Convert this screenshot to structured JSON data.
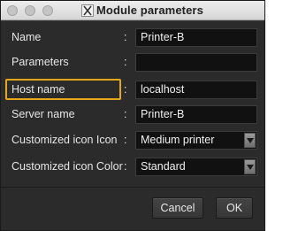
{
  "window": {
    "title": "Module parameters",
    "app_icon": "x-window-icon",
    "controls": [
      "close-button",
      "minimize-button",
      "zoom-button"
    ]
  },
  "form": {
    "fields": [
      {
        "label": "Name",
        "colon": ":",
        "value": "Printer-B",
        "type": "text"
      },
      {
        "label": "Parameters",
        "colon": ":",
        "value": "",
        "type": "text"
      },
      {
        "label": "Host name",
        "colon": ":",
        "value": "localhost",
        "type": "text",
        "highlighted": true
      },
      {
        "label": "Server name",
        "colon": ":",
        "value": "Printer-B",
        "type": "text"
      },
      {
        "label": "Customized icon Icon",
        "colon": ":",
        "value": "Medium printer",
        "type": "select"
      },
      {
        "label": "Customized icon Color",
        "colon": ":",
        "value": "Standard",
        "type": "select"
      }
    ]
  },
  "buttons": {
    "cancel_label": "Cancel",
    "ok_label": "OK"
  },
  "colors": {
    "highlight": "#e6a619",
    "background": "#2b2b2b",
    "field_background": "#111111"
  }
}
